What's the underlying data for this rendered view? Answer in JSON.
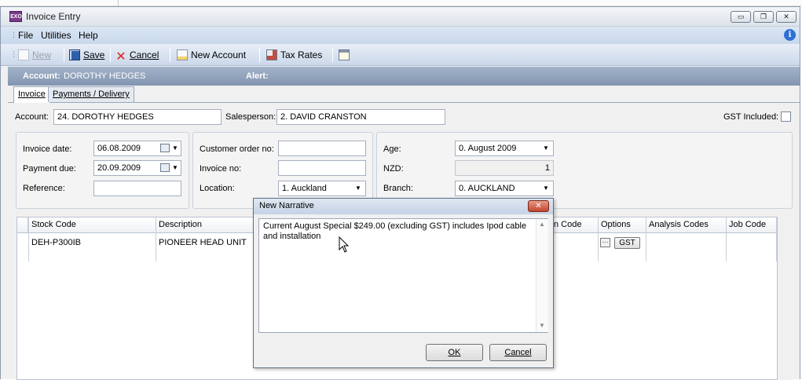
{
  "window": {
    "app_icon_text": "EXO",
    "title": "Invoice Entry",
    "controls": {
      "minimize": "▭",
      "restore": "❐",
      "close": "✕"
    }
  },
  "menu": {
    "items": [
      "File",
      "Utilities",
      "Help"
    ],
    "info_icon": "i"
  },
  "toolbar": {
    "new_label": "New",
    "save_label": "Save",
    "cancel_label": "Cancel",
    "new_account_label": "New Account",
    "tax_rates_label": "Tax Rates"
  },
  "account_bar": {
    "account_label": "Account:",
    "account_name": "DOROTHY HEDGES",
    "alert_label": "Alert:"
  },
  "tabs": [
    {
      "label": "Invoice"
    },
    {
      "label": "Payments / Delivery"
    }
  ],
  "header_fields": {
    "account_label": "Account:",
    "account_value": "24. DOROTHY HEDGES",
    "salesperson_label": "Salesperson:",
    "salesperson_value": "2. DAVID CRANSTON",
    "gst_included_label": "GST Included:"
  },
  "dates": {
    "invoice_date_label": "Invoice date:",
    "invoice_date_value": "06.08.2009",
    "payment_due_label": "Payment due:",
    "payment_due_value": "20.09.2009",
    "reference_label": "Reference:",
    "reference_value": ""
  },
  "order": {
    "customer_order_label": "Customer order no:",
    "customer_order_value": "",
    "invoice_no_label": "Invoice no:",
    "invoice_no_value": "",
    "location_label": "Location:",
    "location_value": "1. Auckland"
  },
  "age": {
    "age_label": "Age:",
    "age_value": "0. August 2009",
    "nzd_label": "NZD:",
    "nzd_value": "1",
    "branch_label": "Branch:",
    "branch_value": "0. AUCKLAND"
  },
  "grid": {
    "columns": [
      "Stock Code",
      "Description",
      "n Code",
      "Options",
      "Analysis Codes",
      "Job Code"
    ],
    "rows": [
      {
        "stock_code": "DEH-P300IB",
        "description": "PIONEER HEAD UNIT",
        "options_more": "···",
        "options_gst": "GST"
      }
    ]
  },
  "dialog": {
    "title": "New Narrative",
    "close_glyph": "✕",
    "text": "Current August Special $249.00 (excluding GST) includes Ipod cable and installation",
    "ok_label": "OK",
    "cancel_label": "Cancel"
  }
}
